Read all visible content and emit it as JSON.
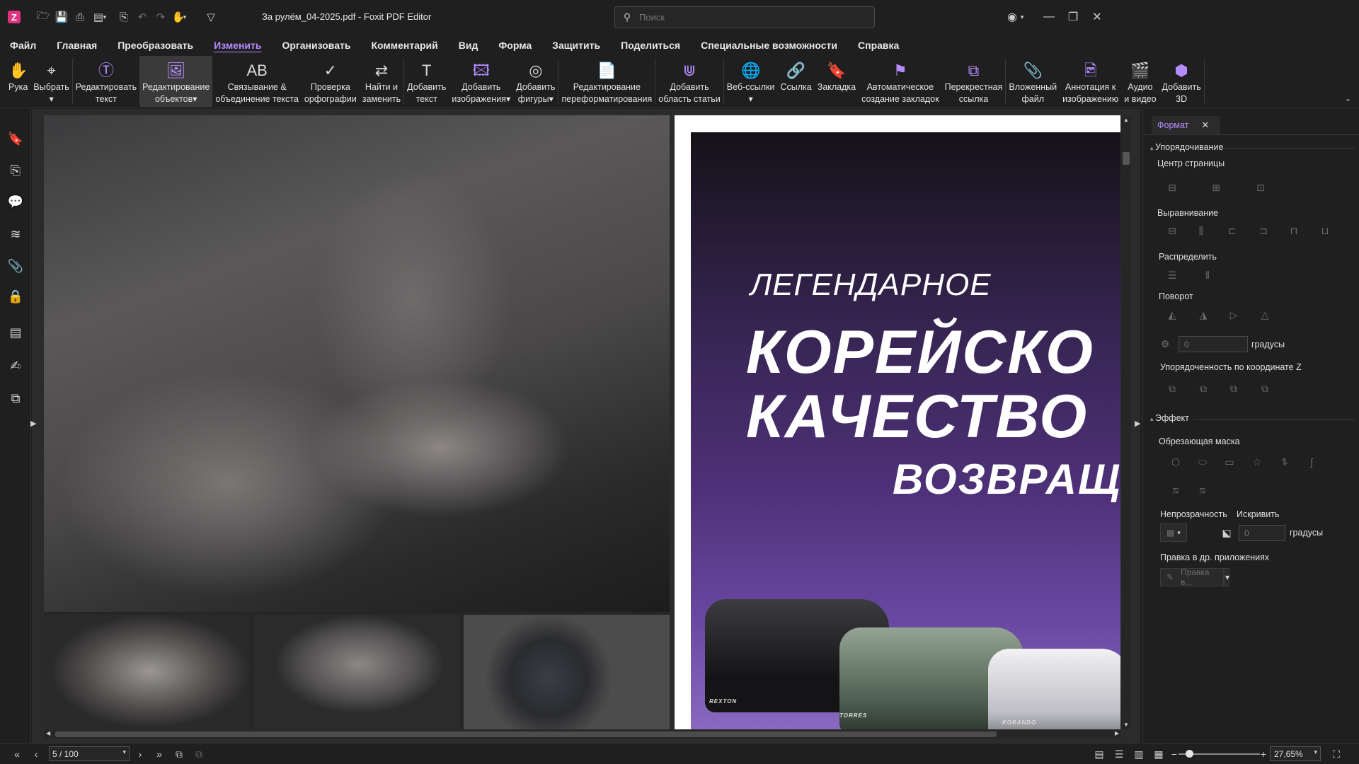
{
  "titlebar": {
    "document_title": "За рулём_04-2025.pdf - Foxit PDF Editor",
    "search_placeholder": "Поиск",
    "app_logo": "Z"
  },
  "menu": [
    "Файл",
    "Главная",
    "Преобразовать",
    "Изменить",
    "Организовать",
    "Комментарий",
    "Вид",
    "Форма",
    "Защитить",
    "Поделиться",
    "Специальные возможности",
    "Справка"
  ],
  "active_menu": "Изменить",
  "ribbon": {
    "hand": [
      "Рука",
      ""
    ],
    "select": [
      "Выбрать",
      "▾"
    ],
    "edit_text": [
      "Редактировать",
      "текст"
    ],
    "edit_objects": [
      "Редактирование",
      "объектов▾"
    ],
    "link_join": [
      "Связывание &",
      "объединение текста"
    ],
    "spell": [
      "Проверка",
      "орфографии"
    ],
    "find_replace": [
      "Найти и",
      "заменить"
    ],
    "add_text": [
      "Добавить",
      "текст"
    ],
    "add_images": [
      "Добавить",
      "изображения▾"
    ],
    "add_shapes": [
      "Добавить",
      "фигуры▾"
    ],
    "reflow": [
      "Редактирование",
      "переформатирования"
    ],
    "article": [
      "Добавить",
      "область статьи"
    ],
    "weblinks": [
      "Веб-ссылки",
      "▾"
    ],
    "link": [
      "Ссылка",
      ""
    ],
    "bookmark": [
      "Закладка",
      ""
    ],
    "auto_bookmarks": [
      "Автоматическое",
      "создание закладок"
    ],
    "cross_ref": [
      "Перекрестная",
      "ссылка"
    ],
    "attached_file": [
      "Вложенный",
      "файл"
    ],
    "image_annot": [
      "Аннотация к",
      "изображению"
    ],
    "audio_video": [
      "Аудио",
      "и видео"
    ],
    "add_3d": [
      "Добавить",
      "3D"
    ]
  },
  "page_right": {
    "line1": "ЛЕГЕНДАРНОЕ",
    "line2": "КОРЕЙСКО",
    "line3": "КАЧЕСТВО",
    "line4": "ВОЗВРАЩА",
    "badges": [
      "REXTON",
      "TORRES",
      "KORANDO"
    ]
  },
  "panel": {
    "tab": "Формат",
    "sec_arrange": "Упорядочивание",
    "page_center": "Центр страницы",
    "align": "Выравнивание",
    "distribute": "Распределить",
    "rotate": "Поворот",
    "rotate_value": "0",
    "degrees": "градусы",
    "z_order": "Упорядоченность по координате Z",
    "sec_effect": "Эффект",
    "clip_mask": "Обрезающая маска",
    "opacity": "Непрозрачность",
    "skew": "Искривить",
    "skew_value": "0",
    "edit_other": "Правка в др. приложениях",
    "edit_in": "Правка в..."
  },
  "status": {
    "page": "5 / 100",
    "zoom": "27,65%"
  },
  "colors": {
    "accent": "#b48cff",
    "background": "#1e1e1e",
    "logo": "#e0337f"
  }
}
